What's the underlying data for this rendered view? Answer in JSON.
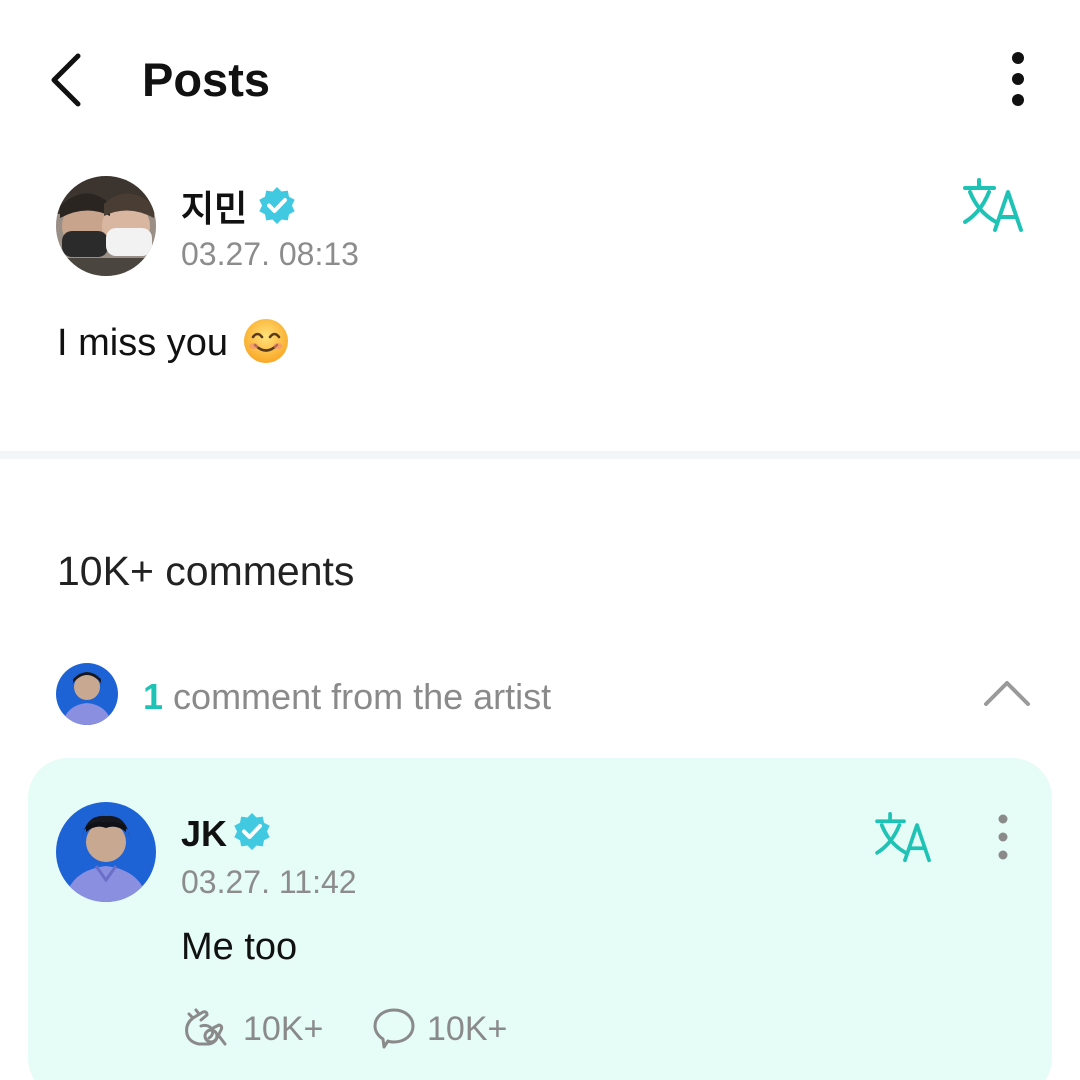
{
  "header": {
    "title": "Posts",
    "back_icon": "chevron-left-icon",
    "more_icon": "vertical-ellipsis-icon"
  },
  "post": {
    "author": "지민",
    "verified_icon": "verified-badge-icon",
    "timestamp": "03.27. 08:13",
    "text": "I miss you",
    "emoji_icon": "smiling-face-emoji",
    "translate_icon": "translate-icon"
  },
  "comments": {
    "heading": "10K+ comments",
    "artist_section": {
      "count": "1",
      "label": "comment from the artist",
      "collapse_icon": "chevron-up-icon"
    },
    "artist_comment": {
      "author": "JK",
      "timestamp": "03.27. 11:42",
      "text": "Me too",
      "likes": "10K+",
      "replies": "10K+",
      "like_icon": "cheer-hands-icon",
      "reply_icon": "speech-bubble-icon"
    }
  },
  "colors": {
    "accent": "#1fc3b5",
    "card_background": "#e6fcf6",
    "muted_text": "#8c8c8c"
  }
}
